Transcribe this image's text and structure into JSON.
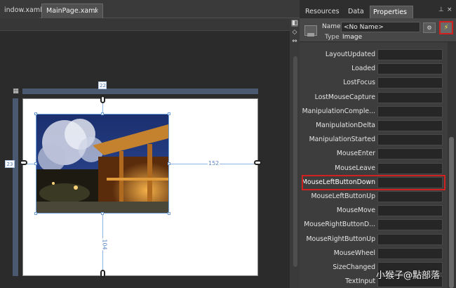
{
  "doc_tabs": [
    {
      "label": "indow.xaml"
    },
    {
      "label": "MainPage.xaml",
      "close": "×"
    }
  ],
  "canvas": {
    "margin_right": "152",
    "margin_bottom": "104",
    "margin_left": "23",
    "margin_top": "22"
  },
  "panel": {
    "tabs": [
      "Resources",
      "Data",
      "Properties"
    ],
    "tab_close": "×",
    "name_label": "Name",
    "name_value": "<No Name>",
    "type_label": "Type",
    "type_value": "Image"
  },
  "events": [
    "LayoutUpdated",
    "Loaded",
    "LostFocus",
    "LostMouseCapture",
    "ManipulationComple...",
    "ManipulationDelta",
    "ManipulationStarted",
    "MouseEnter",
    "MouseLeave",
    "MouseLeftButtonDown",
    "MouseLeftButtonUp",
    "MouseMove",
    "MouseRightButtonD...",
    "MouseRightButtonUp",
    "MouseWheel",
    "SizeChanged",
    "TextInput"
  ],
  "selected_event": "MouseLeftButtonDown",
  "watermark": "小猴子@點部落",
  "colors": {
    "highlight": "#d0201f",
    "panel_bg": "#3d3d3d",
    "design_bg": "#2b2b2b"
  }
}
